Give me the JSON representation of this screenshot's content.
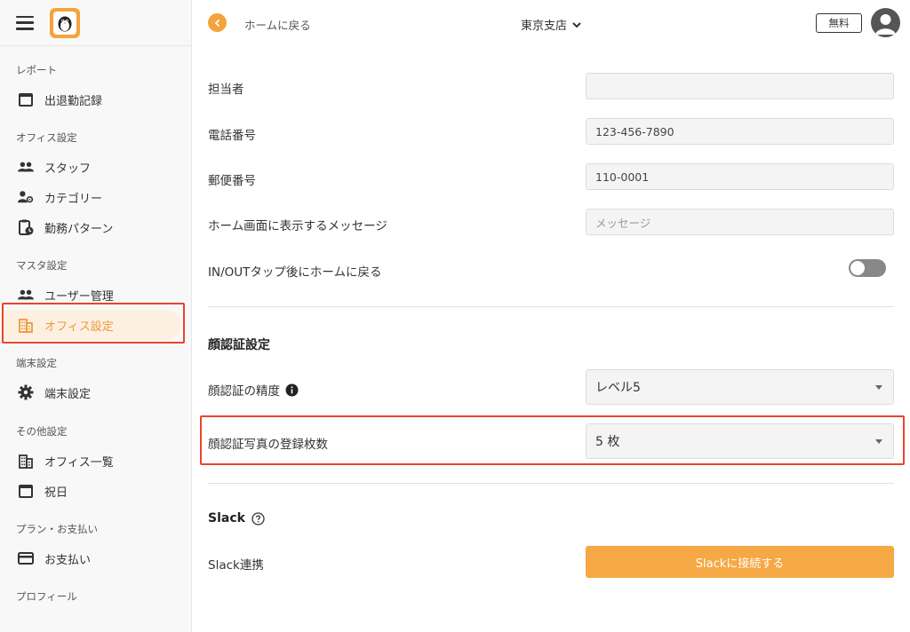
{
  "sidebar": {
    "sections": {
      "report": "レポート",
      "office": "オフィス設定",
      "master": "マスタ設定",
      "device": "端末設定",
      "other": "その他設定",
      "plan": "プラン・お支払い",
      "profile": "プロフィール"
    },
    "items": {
      "attendance": "出退勤記録",
      "staff": "スタッフ",
      "category": "カテゴリー",
      "pattern": "勤務パターン",
      "users": "ユーザー管理",
      "office_settings": "オフィス設定",
      "device_settings": "端末設定",
      "office_list": "オフィス一覧",
      "holidays": "祝日",
      "payment": "お支払い"
    }
  },
  "header": {
    "back_label": "ホームに戻る",
    "branch": "東京支店",
    "plan_badge": "無料"
  },
  "form": {
    "manager_label": "担当者",
    "manager_value": "",
    "phone_label": "電話番号",
    "phone_value": "123-456-7890",
    "postal_label": "郵便番号",
    "postal_value": "110-0001",
    "message_label": "ホーム画面に表示するメッセージ",
    "message_placeholder": "メッセージ",
    "return_home_label": "IN/OUTタップ後にホームに戻る",
    "return_home_on": false
  },
  "face": {
    "section_title": "顔認証設定",
    "accuracy_label": "顔認証の精度",
    "accuracy_value": "レベル5",
    "photo_count_label": "顔認証写真の登録枚数",
    "photo_count_value": "5 枚"
  },
  "slack": {
    "section_title": "Slack",
    "connect_label": "Slack連携",
    "connect_button": "Slackに接続する"
  },
  "colors": {
    "accent": "#f5a33c",
    "highlight": "#e8452c"
  }
}
